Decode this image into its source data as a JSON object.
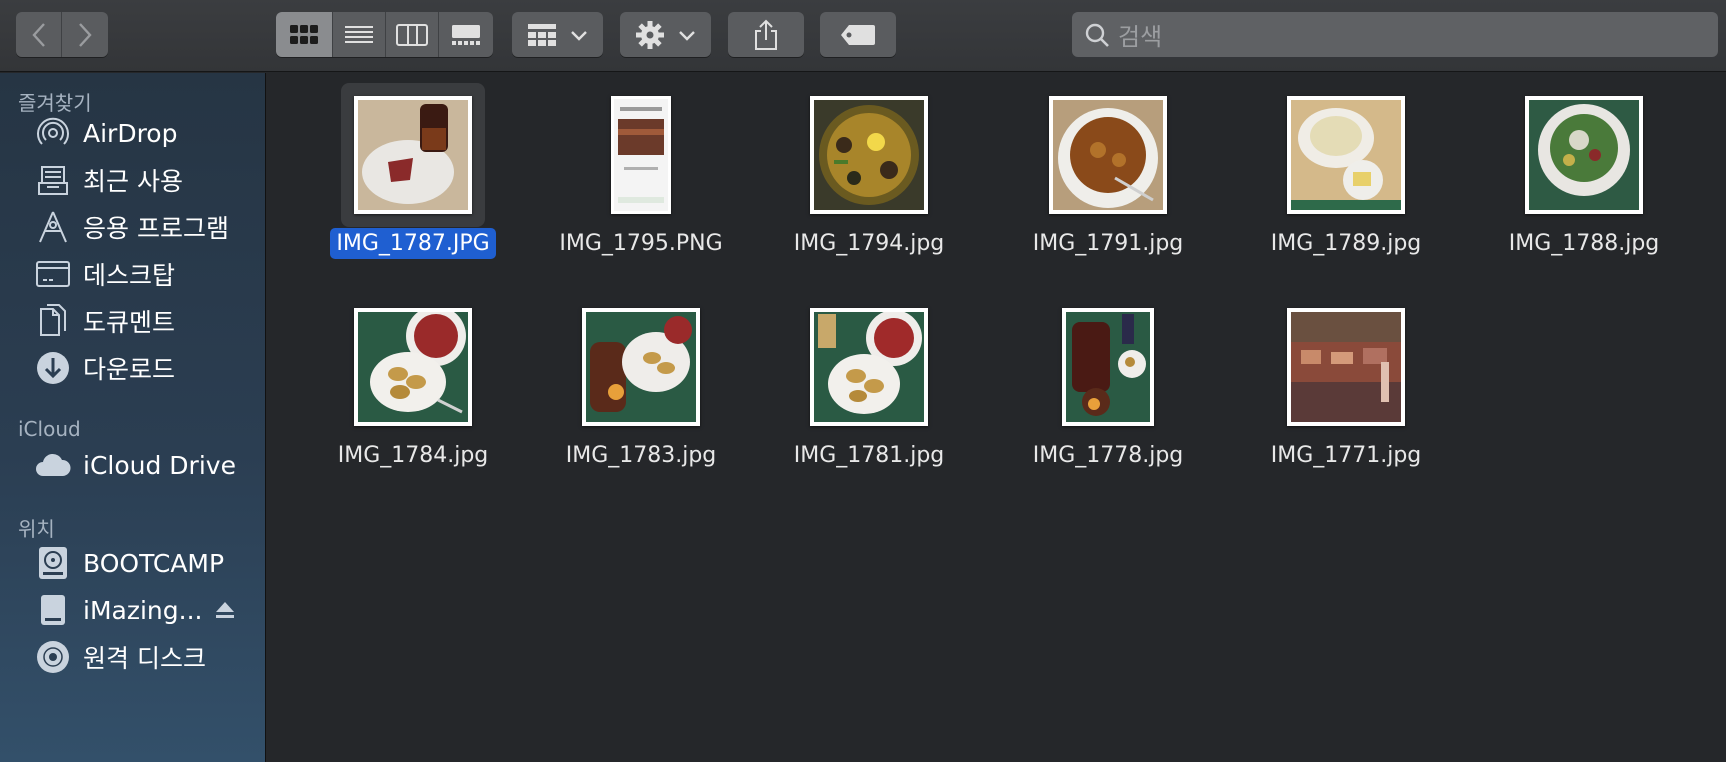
{
  "toolbar": {
    "search_placeholder": "검색"
  },
  "sidebar": {
    "sections": [
      {
        "header": "즐겨찾기",
        "items": [
          {
            "label": "AirDrop",
            "icon": "airdrop-icon"
          },
          {
            "label": "최근 사용",
            "icon": "recents-icon"
          },
          {
            "label": "응용 프로그램",
            "icon": "applications-icon"
          },
          {
            "label": "데스크탑",
            "icon": "desktop-icon"
          },
          {
            "label": "도큐멘트",
            "icon": "document-icon"
          },
          {
            "label": "다운로드",
            "icon": "downloads-icon"
          }
        ]
      },
      {
        "header": "iCloud",
        "items": [
          {
            "label": "iCloud Drive",
            "icon": "cloud-icon"
          }
        ]
      },
      {
        "header": "위치",
        "items": [
          {
            "label": "BOOTCAMP",
            "icon": "internal-disk-icon"
          },
          {
            "label": "iMazing...",
            "icon": "external-disk-icon"
          },
          {
            "label": "원격 디스크",
            "icon": "optical-disc-icon"
          }
        ]
      }
    ]
  },
  "files": [
    {
      "name": "IMG_1787.JPG",
      "selected": true
    },
    {
      "name": "IMG_1795.PNG",
      "selected": false
    },
    {
      "name": "IMG_1794.jpg",
      "selected": false
    },
    {
      "name": "IMG_1791.jpg",
      "selected": false
    },
    {
      "name": "IMG_1789.jpg",
      "selected": false
    },
    {
      "name": "IMG_1788.jpg",
      "selected": false
    },
    {
      "name": "IMG_1784.jpg",
      "selected": false
    },
    {
      "name": "IMG_1783.jpg",
      "selected": false
    },
    {
      "name": "IMG_1781.jpg",
      "selected": false
    },
    {
      "name": "IMG_1778.jpg",
      "selected": false
    },
    {
      "name": "IMG_1771.jpg",
      "selected": false
    }
  ],
  "colors": {
    "selection": "#1f5fd1",
    "toolbar_button": "#5a5c5f",
    "sidebar_top": "#263544",
    "sidebar_bottom": "#33506a",
    "content_bg": "#25272a"
  }
}
